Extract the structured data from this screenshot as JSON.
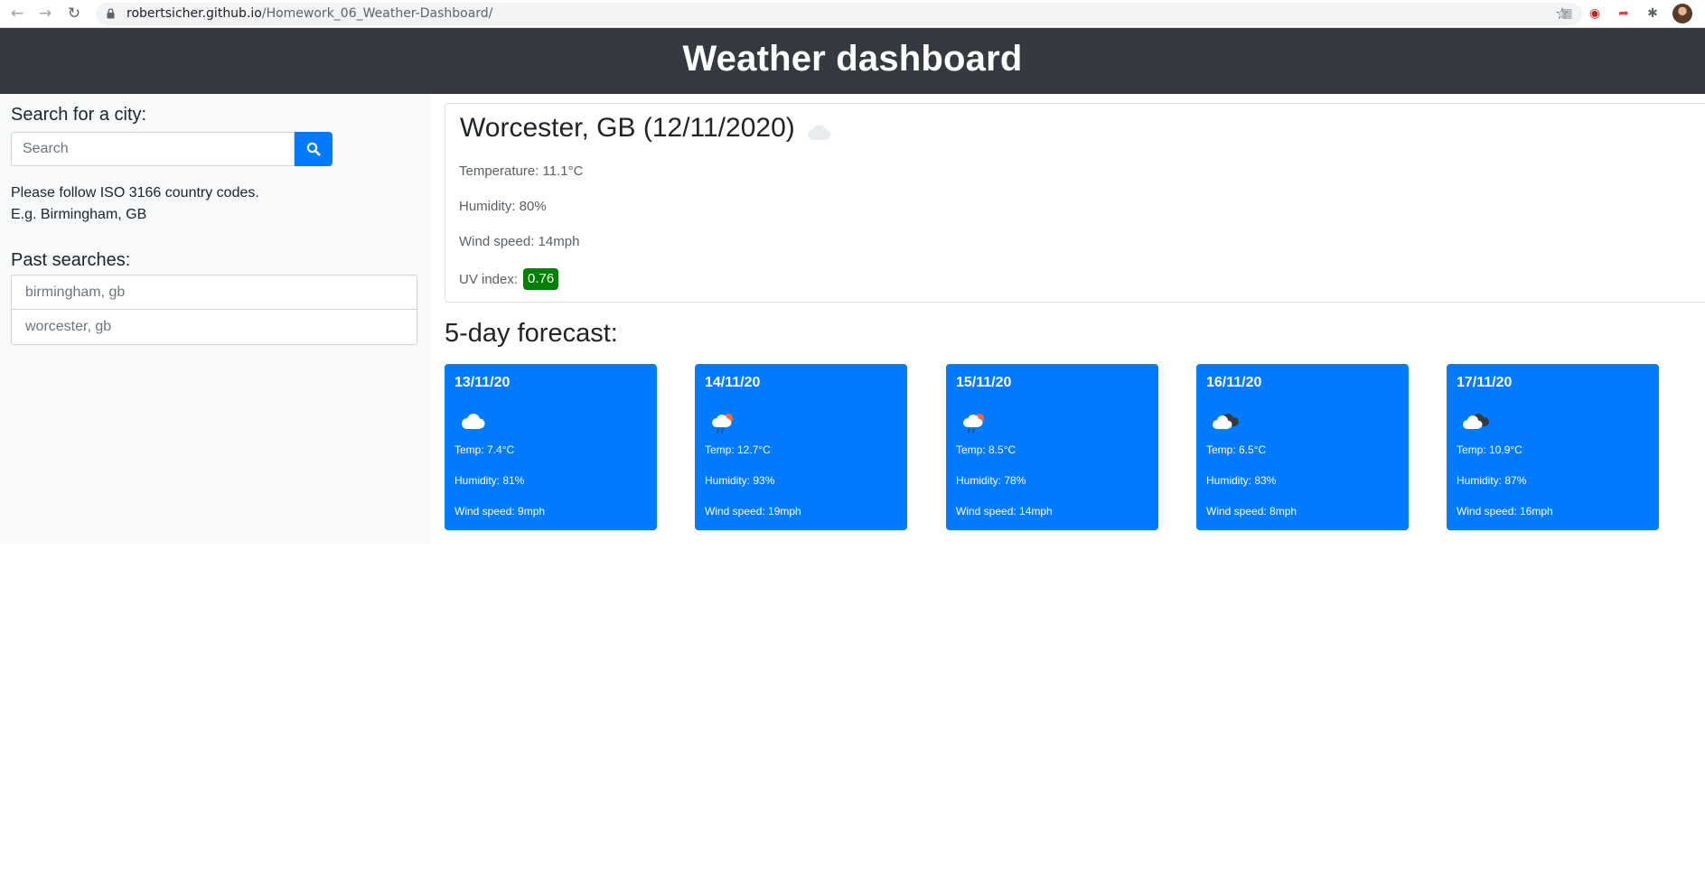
{
  "browser": {
    "url_host": "robertsicher.github.io",
    "url_path": "/Homework_06_Weather-Dashboard/"
  },
  "header": {
    "title": "Weather dashboard",
    "background": "#343a40"
  },
  "sidebar": {
    "search_heading": "Search for a city:",
    "search_placeholder": "Search",
    "search_value": "",
    "search_button_icon": "search-icon",
    "help_line_1": "Please follow ISO 3166 country codes.",
    "help_line_2": "E.g. Birmingham, GB",
    "past_heading": "Past searches:",
    "history": [
      "birmingham, gb",
      "worcester, gb"
    ]
  },
  "current": {
    "title": "Worcester, GB (12/11/2020)",
    "icon": "cloud-icon",
    "temperature": "Temperature: 11.1°C",
    "humidity": "Humidity: 80%",
    "wind": "Wind speed: 14mph",
    "uv_label": "UV index:",
    "uv_value": "0.76",
    "uv_color": "#008000"
  },
  "forecast": {
    "heading": "5-day forecast:",
    "card_color": "#007bff",
    "days": [
      {
        "date": "13/11/20",
        "icon": "cloud-icon",
        "temp": "Temp: 7.4°C",
        "humidity": "Humidity: 81%",
        "wind": "Wind speed: 9mph"
      },
      {
        "date": "14/11/20",
        "icon": "rain-sun-cloud-icon",
        "temp": "Temp: 12.7°C",
        "humidity": "Humidity: 93%",
        "wind": "Wind speed: 19mph"
      },
      {
        "date": "15/11/20",
        "icon": "rain-sun-cloud-icon",
        "temp": "Temp: 8.5°C",
        "humidity": "Humidity: 78%",
        "wind": "Wind speed: 14mph"
      },
      {
        "date": "16/11/20",
        "icon": "broken-clouds-icon",
        "temp": "Temp: 6.5°C",
        "humidity": "Humidity: 83%",
        "wind": "Wind speed: 8mph"
      },
      {
        "date": "17/11/20",
        "icon": "broken-clouds-icon",
        "temp": "Temp: 10.9°C",
        "humidity": "Humidity: 87%",
        "wind": "Wind speed: 16mph"
      }
    ]
  }
}
